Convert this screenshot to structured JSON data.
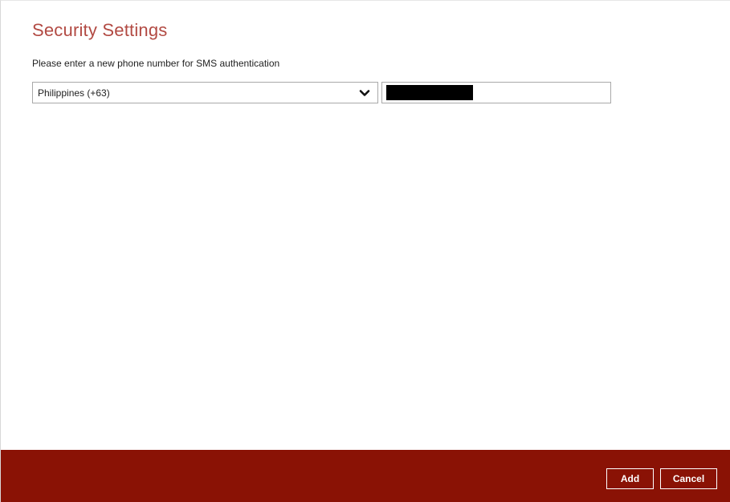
{
  "page": {
    "title": "Security Settings",
    "instruction": "Please enter a new phone number for SMS authentication"
  },
  "country_select": {
    "selected": "Philippines (+63)",
    "icon": "chevron-down-icon"
  },
  "phone_input": {
    "value_redacted": true
  },
  "footer": {
    "add_label": "Add",
    "cancel_label": "Cancel"
  },
  "colors": {
    "title": "#b24a43",
    "footer_bg": "#8a1205",
    "button_border": "#ffffff"
  }
}
